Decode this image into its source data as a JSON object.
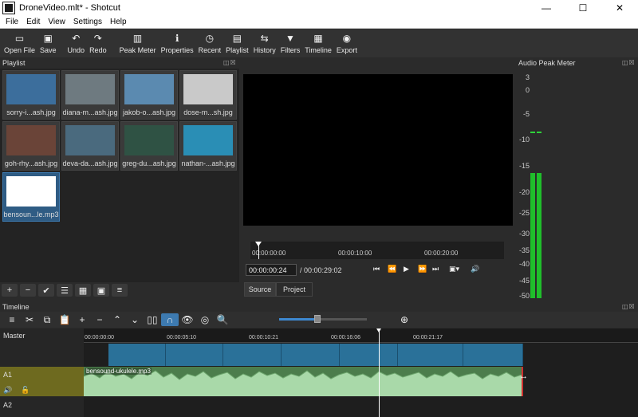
{
  "window": {
    "title": "DroneVideo.mlt* - Shotcut",
    "minimize": "—",
    "maximize": "☐",
    "close": "✕"
  },
  "menu": [
    "File",
    "Edit",
    "View",
    "Settings",
    "Help"
  ],
  "toolbar": [
    {
      "label": "Open File",
      "icon": "open-file-icon",
      "glyph": "▭"
    },
    {
      "label": "Save",
      "icon": "save-icon",
      "glyph": "💾"
    },
    {
      "label": "Undo",
      "icon": "undo-icon",
      "glyph": "↶"
    },
    {
      "label": "Redo",
      "icon": "redo-icon",
      "glyph": "↷"
    },
    {
      "label": "Peak Meter",
      "icon": "peak-meter-icon",
      "glyph": "▥"
    },
    {
      "label": "Properties",
      "icon": "properties-icon",
      "glyph": "ℹ"
    },
    {
      "label": "Recent",
      "icon": "recent-icon",
      "glyph": "◷"
    },
    {
      "label": "Playlist",
      "icon": "playlist-icon",
      "glyph": "▤"
    },
    {
      "label": "History",
      "icon": "history-icon",
      "glyph": "⇆"
    },
    {
      "label": "Filters",
      "icon": "filters-icon",
      "glyph": "▼"
    },
    {
      "label": "Timeline",
      "icon": "timeline-icon",
      "glyph": "▦"
    },
    {
      "label": "Export",
      "icon": "export-icon",
      "glyph": "◉"
    }
  ],
  "playlist": {
    "title": "Playlist",
    "items": [
      {
        "caption": "sorry-i...ash.jpg",
        "color": "#3c6e9c"
      },
      {
        "caption": "diana-m...ash.jpg",
        "color": "#6e7a80"
      },
      {
        "caption": "jakob-o...ash.jpg",
        "color": "#5b8ab0"
      },
      {
        "caption": "dose-m...sh.jpg",
        "color": "#c9c9c9"
      },
      {
        "caption": "goh-rhy...ash.jpg",
        "color": "#6a4438"
      },
      {
        "caption": "deva-da...ash.jpg",
        "color": "#4a6a7e"
      },
      {
        "caption": "greg-du...ash.jpg",
        "color": "#2f5244"
      },
      {
        "caption": "nathan-...ash.jpg",
        "color": "#2a8eb5"
      },
      {
        "caption": "bensoun...le.mp3",
        "color": "#ffffff"
      }
    ]
  },
  "player": {
    "ticks": [
      "00:00:00:00",
      "00:00:10:00",
      "00:00:20:00"
    ],
    "position": "00:00:00:24",
    "duration": "/ 00:00:29:02",
    "tabs": [
      "Source",
      "Project"
    ]
  },
  "meter": {
    "title": "Audio Peak Meter",
    "scale": [
      "3",
      "0",
      "-5",
      "-10",
      "-15",
      "-20",
      "-25",
      "-30",
      "-35",
      "-40",
      "-45",
      "-50"
    ],
    "left_level_db": -17,
    "right_level_db": -17,
    "peak_db": -8
  },
  "timeline": {
    "title": "Timeline",
    "tracks": [
      "Master",
      "A1",
      "A2"
    ],
    "ruler": [
      "00:00:00:00",
      "00:00:05:10",
      "00:00:10:21",
      "00:00:16:06",
      "00:00:21:17"
    ],
    "audio_clip_name": "bensound-ukulele.mp3"
  },
  "colors": {
    "accent": "#2a7199",
    "audio": "#4c7d4c",
    "meter": "#1fbf2b"
  }
}
